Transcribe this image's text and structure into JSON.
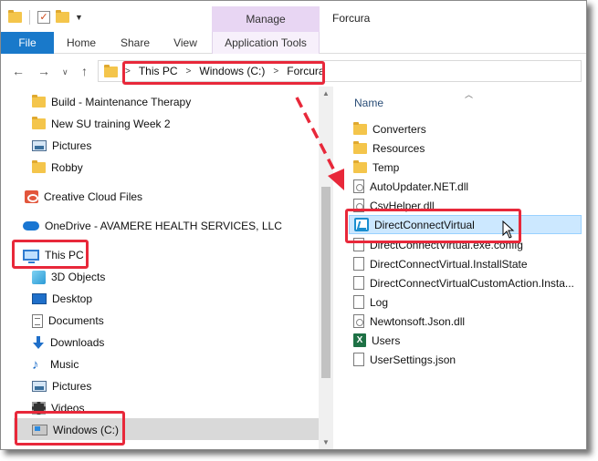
{
  "window": {
    "title": "Forcura",
    "context_tab": "Manage"
  },
  "ribbon": {
    "tabs": [
      "File",
      "Home",
      "Share",
      "View",
      "Application Tools"
    ]
  },
  "address": {
    "crumbs": [
      "This PC",
      "Windows (C:)",
      "Forcura"
    ]
  },
  "nav": {
    "items": [
      {
        "label": "Build - Maintenance Therapy",
        "icon": "folder-icon"
      },
      {
        "label": "New SU training Week 2",
        "icon": "folder-icon"
      },
      {
        "label": "Pictures",
        "icon": "pictures-icon"
      },
      {
        "label": "Robby",
        "icon": "folder-icon"
      },
      {
        "label": "Creative Cloud Files",
        "icon": "creative-cloud-icon"
      },
      {
        "label": "OneDrive - AVAMERE HEALTH SERVICES, LLC",
        "icon": "onedrive-icon"
      },
      {
        "label": "This PC",
        "icon": "this-pc-icon"
      },
      {
        "label": "3D Objects",
        "icon": "3d-objects-icon"
      },
      {
        "label": "Desktop",
        "icon": "desktop-icon"
      },
      {
        "label": "Documents",
        "icon": "documents-icon"
      },
      {
        "label": "Downloads",
        "icon": "downloads-icon"
      },
      {
        "label": "Music",
        "icon": "music-icon"
      },
      {
        "label": "Pictures",
        "icon": "pictures-icon"
      },
      {
        "label": "Videos",
        "icon": "videos-icon"
      },
      {
        "label": "Windows (C:)",
        "icon": "drive-icon"
      }
    ]
  },
  "files": {
    "column_name": "Name",
    "rows": [
      {
        "name": "Converters",
        "icon": "folder-icon"
      },
      {
        "name": "Resources",
        "icon": "folder-icon"
      },
      {
        "name": "Temp",
        "icon": "folder-icon"
      },
      {
        "name": "AutoUpdater.NET.dll",
        "icon": "dll-icon"
      },
      {
        "name": "CsvHelper.dll",
        "icon": "dll-icon"
      },
      {
        "name": "DirectConnectVirtual",
        "icon": "app-exe-icon"
      },
      {
        "name": "DirectConnectVirtual.exe.config",
        "icon": "file-icon"
      },
      {
        "name": "DirectConnectVirtual.InstallState",
        "icon": "file-icon"
      },
      {
        "name": "DirectConnectVirtualCustomAction.Insta...",
        "icon": "file-icon"
      },
      {
        "name": "Log",
        "icon": "file-icon"
      },
      {
        "name": "Newtonsoft.Json.dll",
        "icon": "dll-icon"
      },
      {
        "name": "Users",
        "icon": "excel-icon"
      },
      {
        "name": "UserSettings.json",
        "icon": "file-icon"
      }
    ]
  },
  "colors": {
    "file_tab": "#1979ca",
    "manage_tab": "#e8d6f3",
    "highlight": "#e8283a",
    "selection": "#cce8ff",
    "folder": "#f4c54b"
  }
}
